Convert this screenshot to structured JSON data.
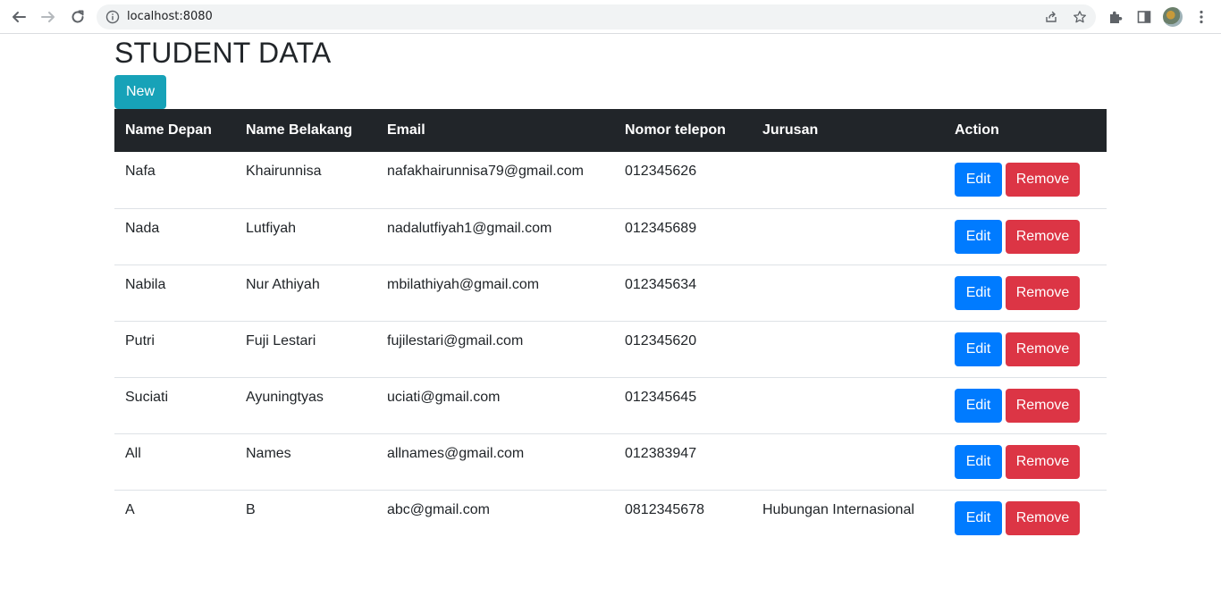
{
  "browser": {
    "url": "localhost:8080"
  },
  "page": {
    "title": "STUDENT DATA",
    "new_label": "New"
  },
  "table": {
    "headers": [
      "Name Depan",
      "Name Belakang",
      "Email",
      "Nomor telepon",
      "Jurusan",
      "Action"
    ],
    "edit_label": "Edit",
    "remove_label": "Remove",
    "rows": [
      {
        "first": "Nafa",
        "last": "Khairunnisa",
        "email": "nafakhairunnisa79@gmail.com",
        "phone": "012345626",
        "major": ""
      },
      {
        "first": "Nada",
        "last": "Lutfiyah",
        "email": "nadalutfiyah1@gmail.com",
        "phone": "012345689",
        "major": ""
      },
      {
        "first": "Nabila",
        "last": "Nur Athiyah",
        "email": "mbilathiyah@gmail.com",
        "phone": "012345634",
        "major": ""
      },
      {
        "first": "Putri",
        "last": "Fuji Lestari",
        "email": "fujilestari@gmail.com",
        "phone": "012345620",
        "major": ""
      },
      {
        "first": "Suciati",
        "last": "Ayuningtyas",
        "email": "uciati@gmail.com",
        "phone": "012345645",
        "major": ""
      },
      {
        "first": "All",
        "last": "Names",
        "email": "allnames@gmail.com",
        "phone": "012383947",
        "major": ""
      },
      {
        "first": "A",
        "last": "B",
        "email": "abc@gmail.com",
        "phone": "0812345678",
        "major": "Hubungan Internasional"
      }
    ]
  },
  "colors": {
    "header_bg": "#212529",
    "new_button": "#17a2b8",
    "edit_button": "#007bff",
    "remove_button": "#dc3545"
  }
}
